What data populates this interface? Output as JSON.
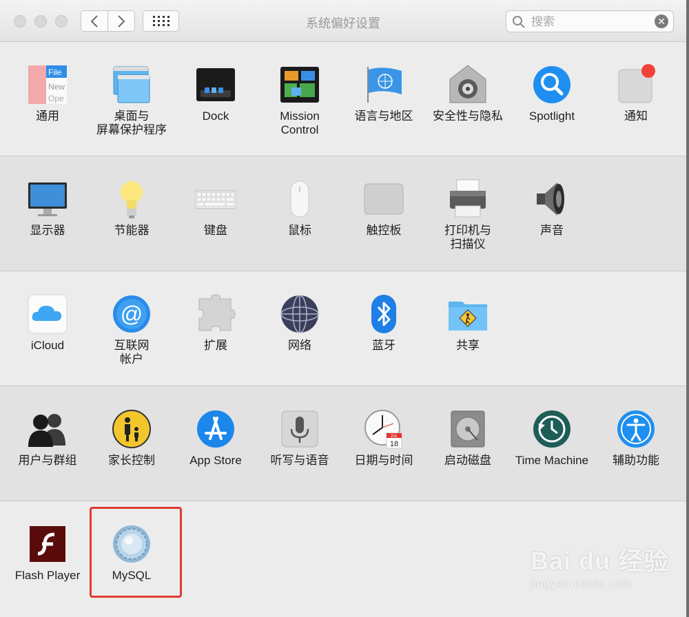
{
  "window": {
    "title": "系统偏好设置"
  },
  "search": {
    "placeholder": "搜索",
    "value": ""
  },
  "sections": [
    {
      "items": [
        {
          "label": "通用",
          "icon": "general-icon"
        },
        {
          "label": "桌面与\n屏幕保护程序",
          "icon": "desktop-screensaver-icon"
        },
        {
          "label": "Dock",
          "icon": "dock-icon"
        },
        {
          "label": "Mission\nControl",
          "icon": "mission-control-icon"
        },
        {
          "label": "语言与地区",
          "icon": "language-region-icon"
        },
        {
          "label": "安全性与隐私",
          "icon": "security-privacy-icon"
        },
        {
          "label": "Spotlight",
          "icon": "spotlight-icon"
        },
        {
          "label": "通知",
          "icon": "notifications-icon"
        }
      ]
    },
    {
      "items": [
        {
          "label": "显示器",
          "icon": "displays-icon"
        },
        {
          "label": "节能器",
          "icon": "energy-saver-icon"
        },
        {
          "label": "键盘",
          "icon": "keyboard-icon"
        },
        {
          "label": "鼠标",
          "icon": "mouse-icon"
        },
        {
          "label": "触控板",
          "icon": "trackpad-icon"
        },
        {
          "label": "打印机与\n扫描仪",
          "icon": "printers-scanners-icon"
        },
        {
          "label": "声音",
          "icon": "sound-icon"
        }
      ]
    },
    {
      "items": [
        {
          "label": "iCloud",
          "icon": "icloud-icon"
        },
        {
          "label": "互联网\n帐户",
          "icon": "internet-accounts-icon"
        },
        {
          "label": "扩展",
          "icon": "extensions-icon"
        },
        {
          "label": "网络",
          "icon": "network-icon"
        },
        {
          "label": "蓝牙",
          "icon": "bluetooth-icon"
        },
        {
          "label": "共享",
          "icon": "sharing-icon"
        }
      ]
    },
    {
      "items": [
        {
          "label": "用户与群组",
          "icon": "users-groups-icon"
        },
        {
          "label": "家长控制",
          "icon": "parental-controls-icon"
        },
        {
          "label": "App Store",
          "icon": "app-store-icon"
        },
        {
          "label": "听写与语音",
          "icon": "dictation-speech-icon"
        },
        {
          "label": "日期与时间",
          "icon": "date-time-icon"
        },
        {
          "label": "启动磁盘",
          "icon": "startup-disk-icon"
        },
        {
          "label": "Time Machine",
          "icon": "time-machine-icon"
        },
        {
          "label": "辅助功能",
          "icon": "accessibility-icon"
        }
      ]
    },
    {
      "items": [
        {
          "label": "Flash Player",
          "icon": "flash-player-icon"
        },
        {
          "label": "MySQL",
          "icon": "mysql-icon"
        }
      ]
    }
  ],
  "icon_text": {
    "general_file": "File",
    "general_new": "New",
    "general_open": "Ope",
    "calendar_month": "JUL",
    "calendar_day": "18"
  },
  "watermark": {
    "brand": "Bai du 经验",
    "url": "jingyan.baidu.com"
  },
  "colors": {
    "highlight": "#e03b2e",
    "accent_blue": "#1e8ff0"
  }
}
